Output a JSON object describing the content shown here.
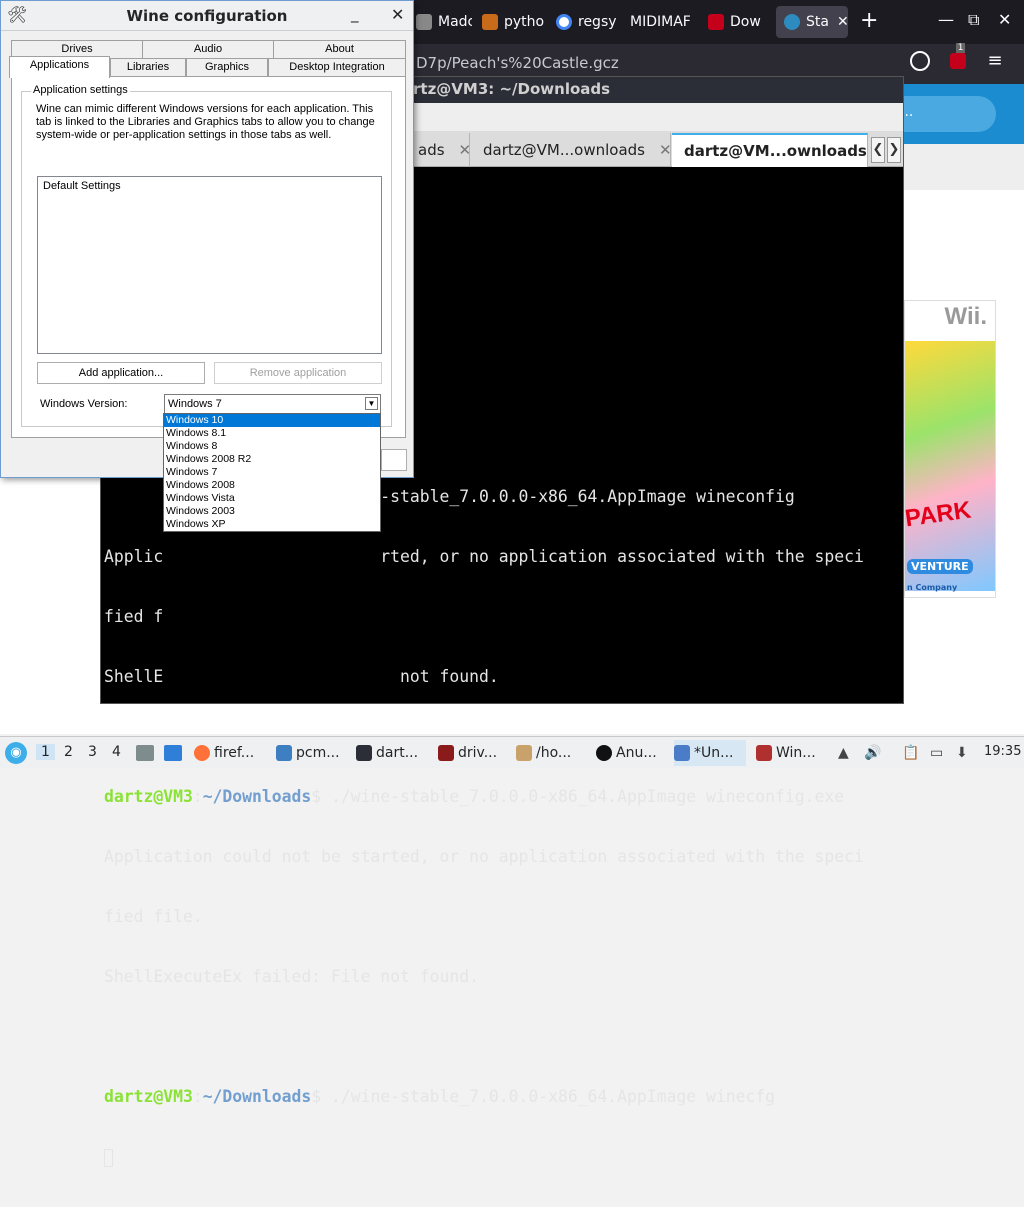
{
  "browser": {
    "tabs": [
      {
        "label": "Madc",
        "color": "#888888"
      },
      {
        "label": "pytho",
        "color": "#c86b1a"
      },
      {
        "label": "regsy",
        "color": "#4285f4"
      },
      {
        "label": "MIDIMAF",
        "color": "#1c1b22"
      },
      {
        "label": "Dow",
        "color": "#c4001a"
      },
      {
        "label": "Sta",
        "color": "#2e8bc0",
        "active": true
      }
    ],
    "new_tab": "+",
    "window_controls": {
      "minimize": "—",
      "restore": "⧉",
      "close": "✕"
    },
    "url": "D7p/Peach's%20Castle.gcz",
    "extension_badge": "1",
    "menu": "≡"
  },
  "webpage": {
    "search_hint": "...",
    "cover": {
      "wii": "Wii.",
      "logo": "PARK",
      "venture": "VENTURE",
      "company": "n Company"
    }
  },
  "terminal": {
    "title": "rtz@VM3: ~/Downloads",
    "tabs": [
      {
        "label": "ads",
        "close": "✕"
      },
      {
        "label": "dartz@VM...ownloads",
        "close": "✕"
      },
      {
        "label": "dartz@VM...ownloads",
        "close": "✕",
        "active": true
      }
    ],
    "scroll_left": "❮",
    "scroll_right": "❯",
    "lines": [
      {
        "text": "                            -stable_7.0.0.0-x86_64.AppImage wineconfig"
      },
      {
        "text": "Applic                      rted, or no application associated with the speci"
      },
      {
        "text": "fied f"
      },
      {
        "text": "ShellE                        not found."
      },
      {
        "text": ""
      },
      {
        "user": "dartz@VM3",
        "path": "~/Downloads",
        "cmd": "$ ./wine-stable_7.0.0.0-x86_64.AppImage wineconfig.exe"
      },
      {
        "text": "Application could not be started, or no application associated with the speci"
      },
      {
        "text": "fied file."
      },
      {
        "text": "ShellExecuteEx failed: File not found."
      },
      {
        "text": ""
      },
      {
        "user": "dartz@VM3",
        "path": "~/Downloads",
        "cmd": "$ ./wine-stable_7.0.0.0-x86_64.AppImage winecfg"
      }
    ]
  },
  "wine": {
    "title": "Wine configuration",
    "minimize": "_",
    "close": "✕",
    "tabs_row1": [
      "Drives",
      "Audio",
      "About"
    ],
    "tabs_row2": [
      "Applications",
      "Libraries",
      "Graphics",
      "Desktop Integration"
    ],
    "group_title": "Application settings",
    "description": "Wine can mimic different Windows versions for each application. This tab is linked to the Libraries and Graphics tabs to allow you to change system-wide or per-application settings in those tabs as well.",
    "list_item": "Default Settings",
    "add_button": "Add application...",
    "remove_button": "Remove application",
    "version_label": "Windows Version:",
    "version_value": "Windows 7",
    "version_options": [
      "Windows 10",
      "Windows 8.1",
      "Windows 8",
      "Windows 2008 R2",
      "Windows 7",
      "Windows 2008",
      "Windows Vista",
      "Windows 2003",
      "Windows XP"
    ],
    "highlighted_option": "Windows 10"
  },
  "taskbar": {
    "desktops": [
      "1",
      "2",
      "3",
      "4"
    ],
    "tasks": [
      {
        "label": "firef...",
        "color": "#ff7139"
      },
      {
        "label": "pcm...",
        "color": "#3d7fc1"
      },
      {
        "label": "dart...",
        "color": "#2b2e37"
      },
      {
        "label": "driv...",
        "color": "#8b1a1a"
      },
      {
        "label": "/ho...",
        "color": "#c9a26b"
      },
      {
        "label": "Anu...",
        "color": "#111111"
      },
      {
        "label": "*Un...",
        "color": "#4a7cc7",
        "active": true
      },
      {
        "label": "Win...",
        "color": "#b03030"
      }
    ],
    "clock": "19:35"
  },
  "colors": {
    "accent": "#3daee9",
    "prompt_user": "#8ae234",
    "prompt_path": "#729fcf",
    "selection": "#0078d7"
  }
}
